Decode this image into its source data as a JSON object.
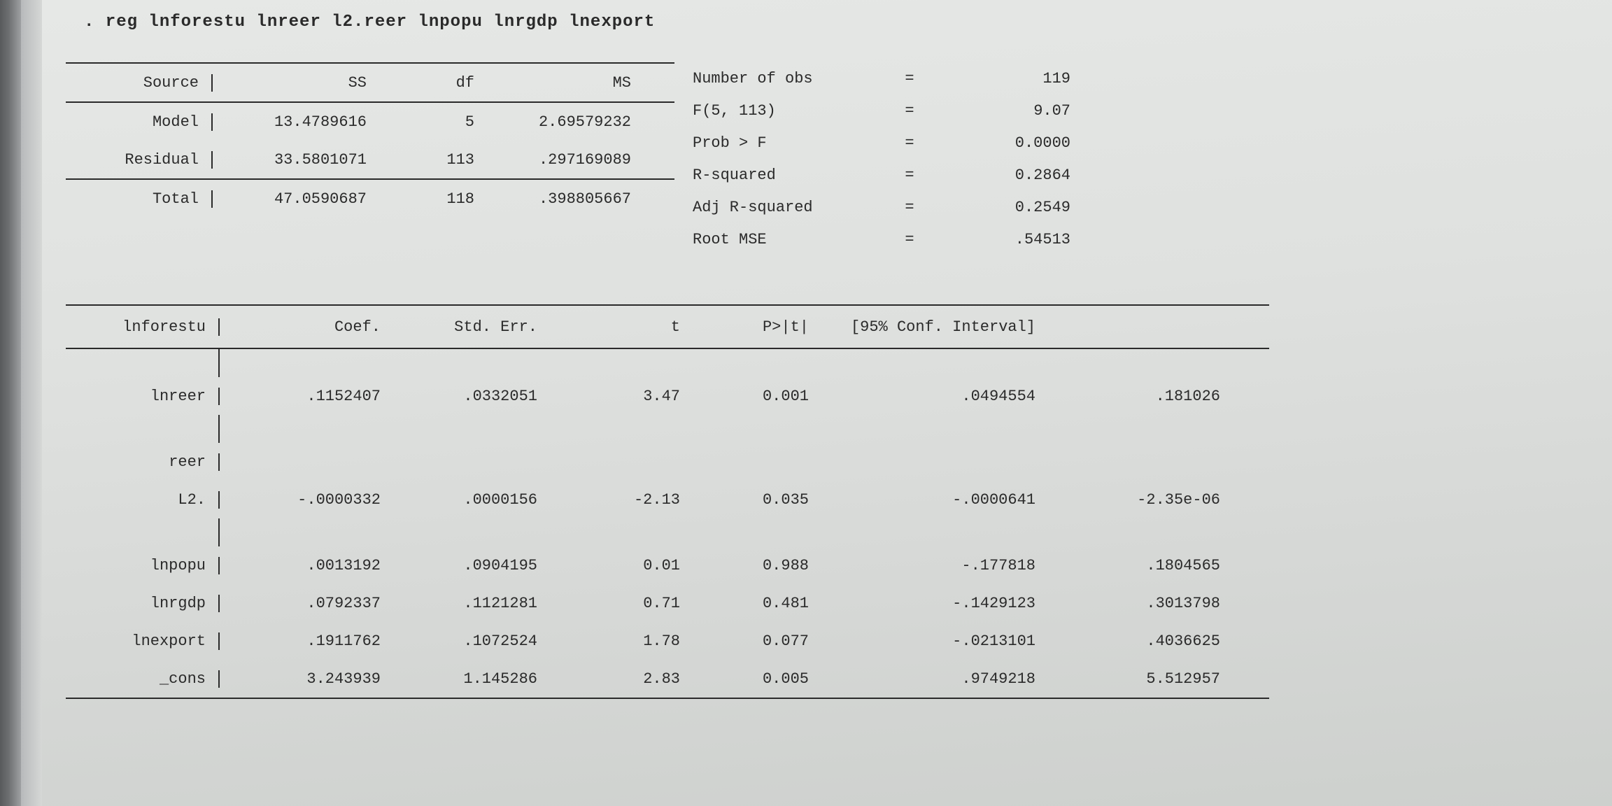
{
  "command": ". reg lnforestu lnreer l2.reer lnpopu lnrgdp lnexport",
  "anova": {
    "headers": {
      "source": "Source",
      "ss": "SS",
      "df": "df",
      "ms": "MS"
    },
    "model": {
      "label": "Model",
      "ss": "13.4789616",
      "df": "5",
      "ms": "2.69579232"
    },
    "residual": {
      "label": "Residual",
      "ss": "33.5801071",
      "df": "113",
      "ms": ".297169089"
    },
    "total": {
      "label": "Total",
      "ss": "47.0590687",
      "df": "118",
      "ms": ".398805667"
    }
  },
  "stats": {
    "nobs": {
      "label": "Number of obs",
      "eq": "=",
      "value": "119"
    },
    "f": {
      "label": "F(5, 113)",
      "eq": "=",
      "value": "9.07"
    },
    "probf": {
      "label": "Prob > F",
      "eq": "=",
      "value": "0.0000"
    },
    "r2": {
      "label": "R-squared",
      "eq": "=",
      "value": "0.2864"
    },
    "adjr2": {
      "label": "Adj R-squared",
      "eq": "=",
      "value": "0.2549"
    },
    "rmse": {
      "label": "Root MSE",
      "eq": "=",
      "value": ".54513"
    }
  },
  "coef": {
    "depvar": "lnforestu",
    "headers": {
      "coef": "Coef.",
      "se": "Std. Err.",
      "t": "t",
      "p": "P>|t|",
      "ci": "[95% Conf. Interval]"
    },
    "rows": {
      "lnreer": {
        "var": "lnreer",
        "coef": ".1152407",
        "se": ".0332051",
        "t": "3.47",
        "p": "0.001",
        "lo": ".0494554",
        "hi": ".181026"
      },
      "reer_hdr": {
        "var": "reer"
      },
      "reer_l2": {
        "var": "L2.",
        "coef": "-.0000332",
        "se": ".0000156",
        "t": "-2.13",
        "p": "0.035",
        "lo": "-.0000641",
        "hi": "-2.35e-06"
      },
      "lnpopu": {
        "var": "lnpopu",
        "coef": ".0013192",
        "se": ".0904195",
        "t": "0.01",
        "p": "0.988",
        "lo": "-.177818",
        "hi": ".1804565"
      },
      "lnrgdp": {
        "var": "lnrgdp",
        "coef": ".0792337",
        "se": ".1121281",
        "t": "0.71",
        "p": "0.481",
        "lo": "-.1429123",
        "hi": ".3013798"
      },
      "lnexport": {
        "var": "lnexport",
        "coef": ".1911762",
        "se": ".1072524",
        "t": "1.78",
        "p": "0.077",
        "lo": "-.0213101",
        "hi": ".4036625"
      },
      "cons": {
        "var": "_cons",
        "coef": "3.243939",
        "se": "1.145286",
        "t": "2.83",
        "p": "0.005",
        "lo": ".9749218",
        "hi": "5.512957"
      }
    }
  }
}
